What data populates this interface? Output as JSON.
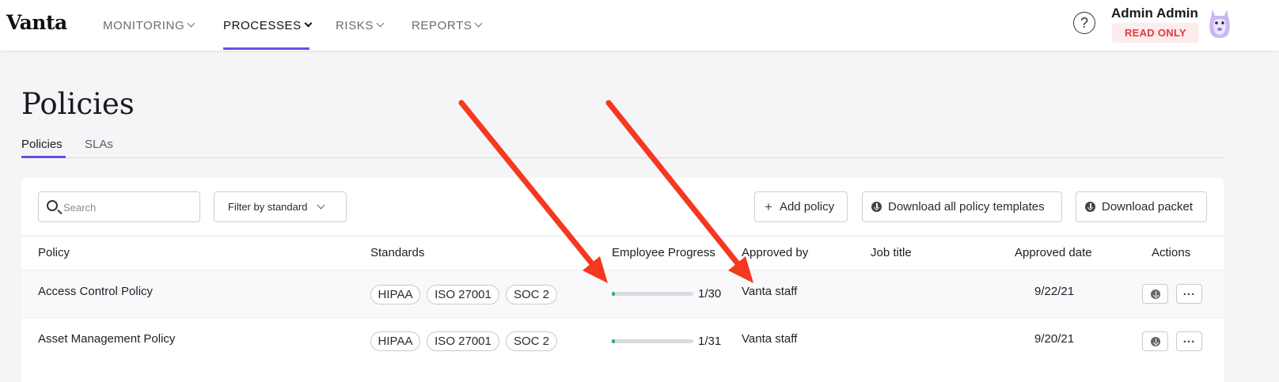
{
  "brand": "Vanta",
  "nav": {
    "items": [
      {
        "label": "MONITORING"
      },
      {
        "label": "PROCESSES"
      },
      {
        "label": "RISKS"
      },
      {
        "label": "REPORTS"
      }
    ],
    "active": "PROCESSES"
  },
  "user": {
    "name": "Admin Admin",
    "badge": "READ ONLY",
    "help_icon": "question-circle-icon"
  },
  "page": {
    "title": "Policies",
    "tabs": [
      {
        "label": "Policies"
      },
      {
        "label": "SLAs"
      }
    ],
    "active_tab": "Policies"
  },
  "toolbar": {
    "search_placeholder": "Search",
    "filter_label": "Filter by standard",
    "add_label": "Add policy",
    "download_templates_label": "Download all policy templates",
    "download_packet_label": "Download packet"
  },
  "table": {
    "columns": [
      "Policy",
      "Standards",
      "Employee Progress",
      "Approved by",
      "Job title",
      "Approved date",
      "Actions"
    ],
    "rows": [
      {
        "policy": "Access Control Policy",
        "standards": [
          "HIPAA",
          "ISO 27001",
          "SOC 2"
        ],
        "progress_text": "1/30",
        "progress_fraction": 0.033,
        "approved_by": "Vanta staff",
        "job_title": "",
        "approved_date": "9/22/21"
      },
      {
        "policy": "Asset Management Policy",
        "standards": [
          "HIPAA",
          "ISO 27001",
          "SOC 2"
        ],
        "progress_text": "1/31",
        "progress_fraction": 0.032,
        "approved_by": "Vanta staff",
        "job_title": "",
        "approved_date": "9/20/21"
      }
    ]
  },
  "colors": {
    "accent": "#6c4ee0",
    "progress": "#2fb36b",
    "badge_text": "#e03b3b",
    "annotation_arrow": "#f5381f"
  }
}
